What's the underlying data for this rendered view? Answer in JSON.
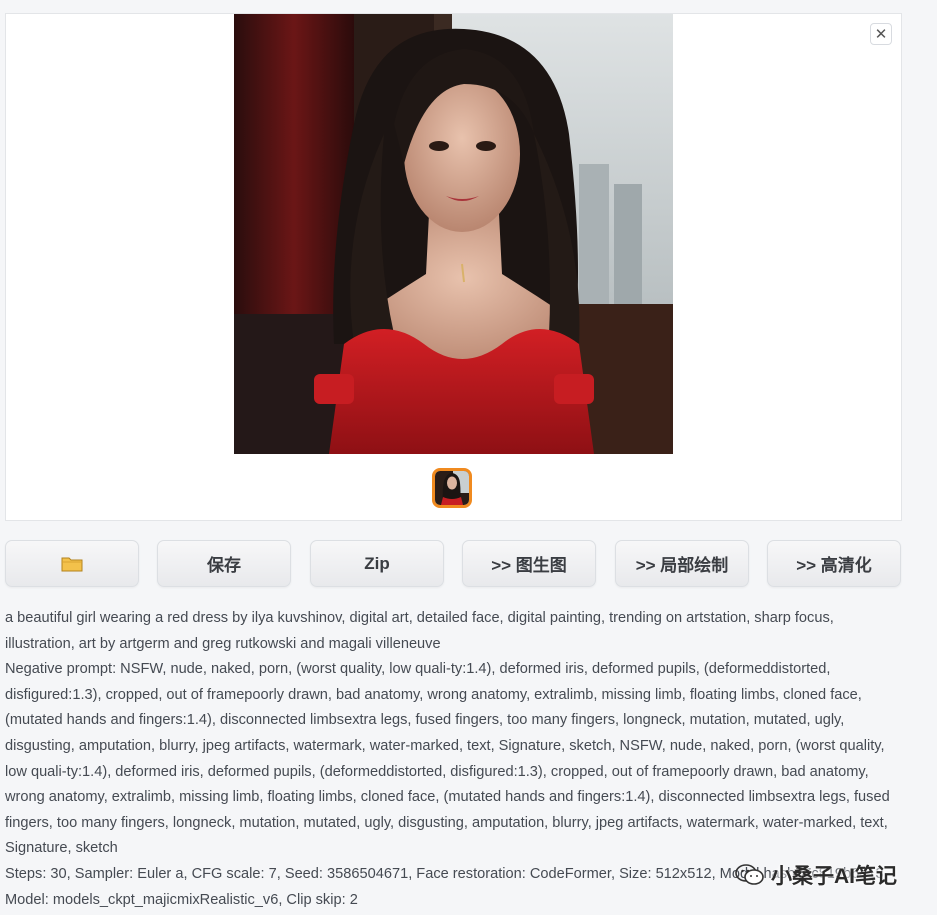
{
  "gallery": {
    "close_icon": "close-icon",
    "image_alt": "generated portrait"
  },
  "toolbar": {
    "folder_icon": "folder-icon",
    "save_label": "保存",
    "zip_label": "Zip",
    "img2img_label": ">> 图生图",
    "inpaint_label": ">> 局部绘制",
    "upscale_label": ">> 高清化"
  },
  "info": {
    "prompt": "a beautiful girl wearing a red dress by ilya kuvshinov, digital art, detailed face, digital painting, trending on artstation, sharp focus, illustration, art by artgerm and greg rutkowski and magali villeneuve",
    "negative_prompt": "Negative prompt: NSFW, nude, naked, porn, (worst quality, low quali-ty:1.4), deformed iris, deformed pupils, (deformeddistorted, disfigured:1.3), cropped, out of framepoorly drawn, bad anatomy, wrong anatomy, extralimb, missing limb, floating limbs, cloned face, (mutated hands and fingers:1.4), disconnected limbsextra legs, fused fingers, too many fingers, longneck, mutation, mutated, ugly, disgusting, amputation, blurry, jpeg artifacts, watermark, water-marked, text, Signature, sketch, NSFW, nude, naked, porn, (worst quality, low quali-ty:1.4), deformed iris, deformed pupils, (deformeddistorted, disfigured:1.3), cropped, out of framepoorly drawn, bad anatomy, wrong anatomy, extralimb, missing limb, floating limbs, cloned face, (mutated hands and fingers:1.4), disconnected limbsextra legs, fused fingers, too many fingers, longneck, mutation, mutated, ugly, disgusting, amputation, blurry, jpeg artifacts, watermark, water-marked, text, Signature, sketch",
    "params": "Steps: 30, Sampler: Euler a, CFG scale: 7, Seed: 3586504671, Face restoration: CodeFormer, Size: 512x512, Model hash: 7c819b6d13,",
    "model": "Model: models_ckpt_majicmixRealistic_v6, Clip skip: 2"
  },
  "watermark": {
    "icon": "wechat-icon",
    "text": "小桑子AI笔记"
  }
}
